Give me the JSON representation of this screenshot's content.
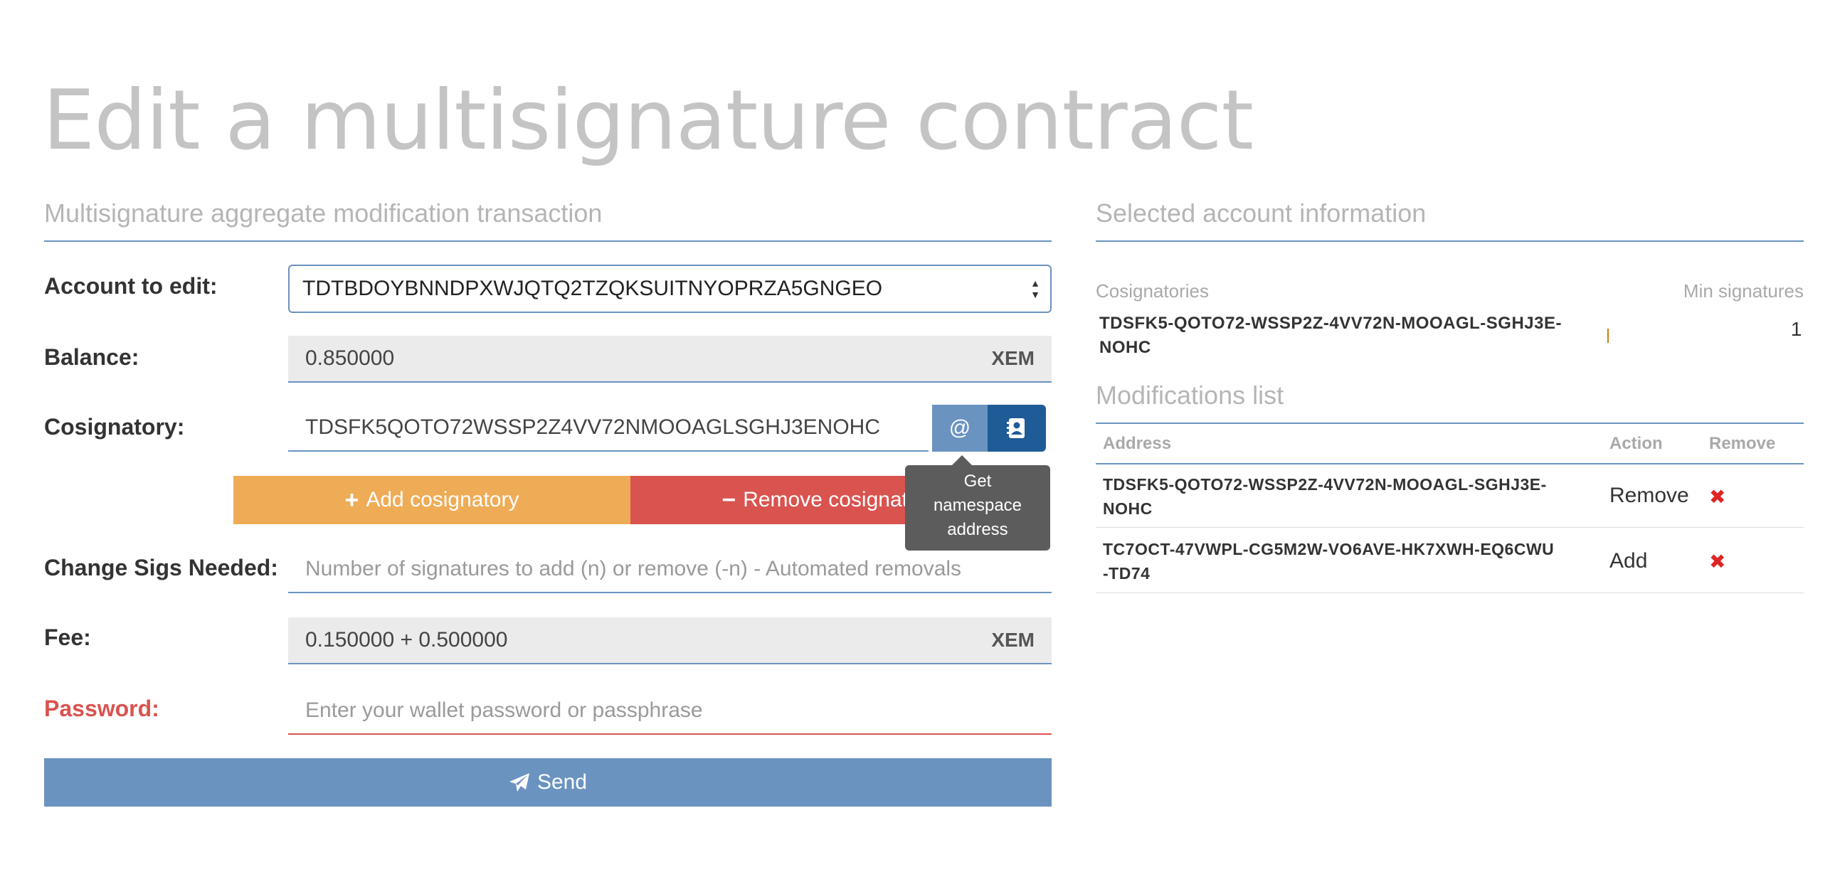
{
  "page": {
    "title": "Edit a multisignature contract"
  },
  "form": {
    "section_title": "Multisignature aggregate modification transaction",
    "account_label": "Account to edit:",
    "account_value": "TDTBDOYBNNDPXWJQTQ2TZQKSUITNYOPRZA5GNGEO",
    "balance_label": "Balance:",
    "balance_value": "0.850000",
    "balance_unit": "XEM",
    "cosignatory_label": "Cosignatory:",
    "cosignatory_value": "TDSFK5QOTO72WSSP2Z4VV72NMOOAGLSGHJ3ENOHC",
    "namespace_button_label": "@",
    "add_cosignatory_label": "Add cosignatory",
    "remove_cosignatory_label": "Remove cosignatory",
    "tooltip_text": [
      "Get",
      "namespace",
      "address"
    ],
    "sigs_label": "Change Sigs Needed:",
    "sigs_placeholder": "Number of signatures to add (n) or remove (-n) - Automated removals",
    "fee_label": "Fee:",
    "fee_value": "0.150000 + 0.500000",
    "fee_unit": "XEM",
    "password_label": "Password:",
    "password_placeholder": "Enter your wallet password or passphrase",
    "send_label": "Send"
  },
  "account_info": {
    "section_title": "Selected account information",
    "cosignatories_header": "Cosignatories",
    "min_signatures_header": "Min signatures",
    "cosignatory_line1": "TDSFK5-QOTO72-WSSP2Z-4VV72N-MOOAGL-SGHJ3E-",
    "cosignatory_line2": "NOHC",
    "min_signatures_value": "1"
  },
  "modifications": {
    "section_title": "Modifications list",
    "columns": [
      "Address",
      "Action",
      "Remove"
    ],
    "rows": [
      {
        "address_line1": "TDSFK5-QOTO72-WSSP2Z-4VV72N-MOOAGL-SGHJ3E-",
        "address_line2": "NOHC",
        "action": "Remove",
        "remove": "✖"
      },
      {
        "address_line1": "TC7OCT-47VWPL-CG5M2W-VO6AVE-HK7XWH-EQ6CWU",
        "address_line2": "-TD74",
        "action": "Add",
        "remove": "✖"
      }
    ]
  }
}
